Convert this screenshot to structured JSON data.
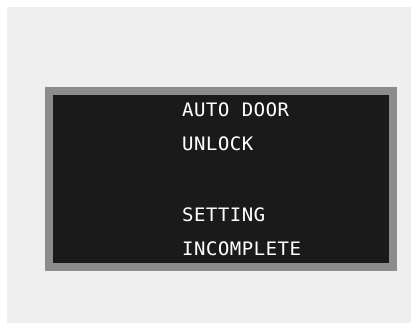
{
  "display": {
    "lines": [
      "AUTO DOOR",
      "UNLOCK",
      "SETTING",
      "INCOMPLETE"
    ]
  },
  "colors": {
    "page_background": "#ffffff",
    "panel_background": "#efefef",
    "bezel": "#8c8c8c",
    "screen": "#1a1a1a",
    "text": "#ffffff"
  }
}
